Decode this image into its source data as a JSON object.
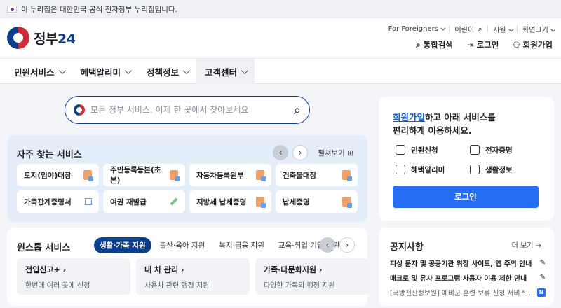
{
  "gov_banner": {
    "text": "이 누리집은 대한민국 공식 전자정부 누리집입니다."
  },
  "header": {
    "logo_text": "정부",
    "logo_num": "24",
    "util_links": [
      "For Foreigners",
      "어린이",
      "지원",
      "화면크기"
    ],
    "util_main": {
      "search": "통합검색",
      "login": "로그인",
      "signup": "회원가입"
    }
  },
  "nav": [
    {
      "label": "민원서비스"
    },
    {
      "label": "혜택알리미"
    },
    {
      "label": "정책정보"
    },
    {
      "label": "고객센터"
    }
  ],
  "search": {
    "placeholder": "모든 정부 서비스, 이제 한 곳에서 찾아보세요"
  },
  "frequent": {
    "title": "자주 찾는 서비스",
    "edit_label": "펼쳐보기",
    "items": [
      {
        "label": "토지(임야)대장",
        "icon": "doc"
      },
      {
        "label": "주민등록등본(초본)",
        "icon": "doc"
      },
      {
        "label": "자동차등록원부",
        "icon": "doc"
      },
      {
        "label": "건축물대장",
        "icon": "doc"
      },
      {
        "label": "가족관계증명서",
        "icon": "external"
      },
      {
        "label": "여권 재발급",
        "icon": "pen"
      },
      {
        "label": "지방세 납세증명",
        "icon": "doc"
      },
      {
        "label": "납세증명",
        "icon": "doc"
      }
    ]
  },
  "onestop": {
    "title": "원스톱 서비스",
    "tabs": [
      "생활·가족 지원",
      "출산·육아 지원",
      "복지·금융 지원",
      "교육·취업·기업 지원"
    ],
    "cards": [
      {
        "title": "전입신고+",
        "desc": "한번에 여러 곳에 신청"
      },
      {
        "title": "내 차 관리",
        "desc": "사용차 관련 행정 지원"
      },
      {
        "title": "가족·다문화지원",
        "desc": "다양한 가족의 행정 지원"
      }
    ]
  },
  "login_box": {
    "head_link": "회원가입",
    "head_rest": "하고 아래 서비스를",
    "head_line2": "편리하게 이용하세요.",
    "items": [
      "민원신청",
      "전자증명",
      "혜택알리미",
      "생활정보"
    ],
    "button": "로그인"
  },
  "notice": {
    "title": "공지사항",
    "more": "더 보기",
    "items": [
      {
        "text": "피싱 문자 및 공공기관 위장 사이트, 앱 주의 안내",
        "pinned": true
      },
      {
        "text": "매크로 및 유사 프로그램 사용자 이용 제한 안내",
        "pinned": true
      },
      {
        "text": "[국방전산정보원] 예비군 훈련 보류 신청 서비스 ...",
        "pinned": false,
        "badge": "N"
      }
    ]
  }
}
